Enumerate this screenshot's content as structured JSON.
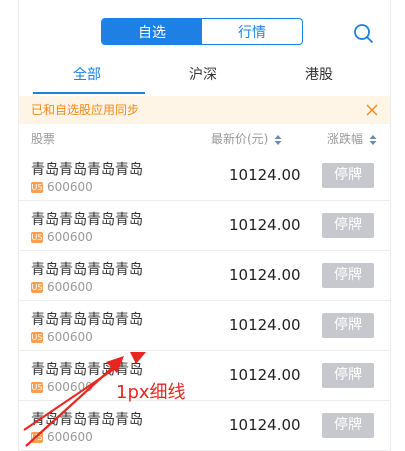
{
  "top_tabs": [
    "自选",
    "行情"
  ],
  "sub_tabs": [
    "全部",
    "沪深",
    "港股"
  ],
  "notice": {
    "text": "已和自选股应用同步"
  },
  "columns": [
    "股票",
    "最新价(元)",
    "涨跌幅"
  ],
  "rows": [
    {
      "name": "青岛青岛青岛青岛",
      "badge": "US",
      "code": "600600",
      "price": "10124.00",
      "status": "停牌"
    },
    {
      "name": "青岛青岛青岛青岛",
      "badge": "US",
      "code": "600600",
      "price": "10124.00",
      "status": "停牌"
    },
    {
      "name": "青岛青岛青岛青岛",
      "badge": "US",
      "code": "600600",
      "price": "10124.00",
      "status": "停牌"
    },
    {
      "name": "青岛青岛青岛青岛",
      "badge": "US",
      "code": "600600",
      "price": "10124.00",
      "status": "停牌"
    },
    {
      "name": "青岛青岛青岛青岛",
      "badge": "US",
      "code": "600600",
      "price": "10124.00",
      "status": "停牌"
    },
    {
      "name": "青岛青岛青岛青岛",
      "badge": "US",
      "code": "600600",
      "price": "10124.00",
      "status": "停牌"
    }
  ],
  "annotation": "1px细线",
  "colors": {
    "accent": "#1e7fe4",
    "notice_text": "#f08a1a",
    "notice_bg": "#fff5e6",
    "status_bg": "#c7c8cd",
    "annotation": "#e8261f"
  }
}
